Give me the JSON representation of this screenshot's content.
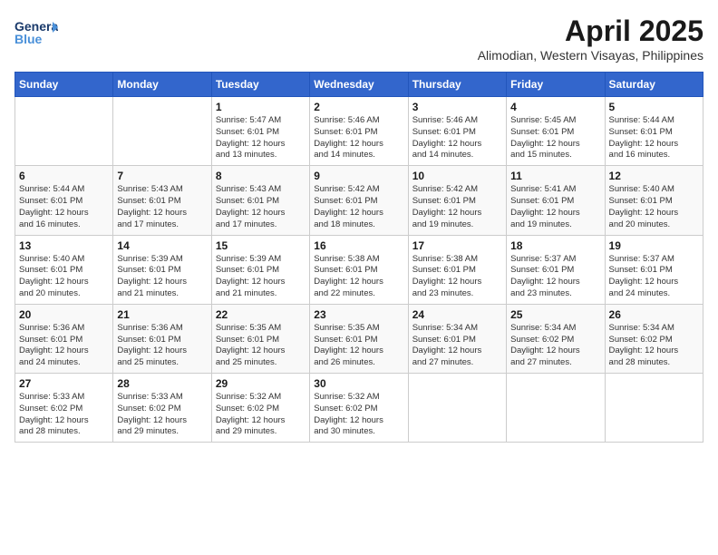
{
  "header": {
    "logo_line1": "General",
    "logo_line2": "Blue",
    "month_title": "April 2025",
    "location": "Alimodian, Western Visayas, Philippines"
  },
  "weekdays": [
    "Sunday",
    "Monday",
    "Tuesday",
    "Wednesday",
    "Thursday",
    "Friday",
    "Saturday"
  ],
  "weeks": [
    [
      {
        "day": "",
        "info": ""
      },
      {
        "day": "",
        "info": ""
      },
      {
        "day": "1",
        "info": "Sunrise: 5:47 AM\nSunset: 6:01 PM\nDaylight: 12 hours\nand 13 minutes."
      },
      {
        "day": "2",
        "info": "Sunrise: 5:46 AM\nSunset: 6:01 PM\nDaylight: 12 hours\nand 14 minutes."
      },
      {
        "day": "3",
        "info": "Sunrise: 5:46 AM\nSunset: 6:01 PM\nDaylight: 12 hours\nand 14 minutes."
      },
      {
        "day": "4",
        "info": "Sunrise: 5:45 AM\nSunset: 6:01 PM\nDaylight: 12 hours\nand 15 minutes."
      },
      {
        "day": "5",
        "info": "Sunrise: 5:44 AM\nSunset: 6:01 PM\nDaylight: 12 hours\nand 16 minutes."
      }
    ],
    [
      {
        "day": "6",
        "info": "Sunrise: 5:44 AM\nSunset: 6:01 PM\nDaylight: 12 hours\nand 16 minutes."
      },
      {
        "day": "7",
        "info": "Sunrise: 5:43 AM\nSunset: 6:01 PM\nDaylight: 12 hours\nand 17 minutes."
      },
      {
        "day": "8",
        "info": "Sunrise: 5:43 AM\nSunset: 6:01 PM\nDaylight: 12 hours\nand 17 minutes."
      },
      {
        "day": "9",
        "info": "Sunrise: 5:42 AM\nSunset: 6:01 PM\nDaylight: 12 hours\nand 18 minutes."
      },
      {
        "day": "10",
        "info": "Sunrise: 5:42 AM\nSunset: 6:01 PM\nDaylight: 12 hours\nand 19 minutes."
      },
      {
        "day": "11",
        "info": "Sunrise: 5:41 AM\nSunset: 6:01 PM\nDaylight: 12 hours\nand 19 minutes."
      },
      {
        "day": "12",
        "info": "Sunrise: 5:40 AM\nSunset: 6:01 PM\nDaylight: 12 hours\nand 20 minutes."
      }
    ],
    [
      {
        "day": "13",
        "info": "Sunrise: 5:40 AM\nSunset: 6:01 PM\nDaylight: 12 hours\nand 20 minutes."
      },
      {
        "day": "14",
        "info": "Sunrise: 5:39 AM\nSunset: 6:01 PM\nDaylight: 12 hours\nand 21 minutes."
      },
      {
        "day": "15",
        "info": "Sunrise: 5:39 AM\nSunset: 6:01 PM\nDaylight: 12 hours\nand 21 minutes."
      },
      {
        "day": "16",
        "info": "Sunrise: 5:38 AM\nSunset: 6:01 PM\nDaylight: 12 hours\nand 22 minutes."
      },
      {
        "day": "17",
        "info": "Sunrise: 5:38 AM\nSunset: 6:01 PM\nDaylight: 12 hours\nand 23 minutes."
      },
      {
        "day": "18",
        "info": "Sunrise: 5:37 AM\nSunset: 6:01 PM\nDaylight: 12 hours\nand 23 minutes."
      },
      {
        "day": "19",
        "info": "Sunrise: 5:37 AM\nSunset: 6:01 PM\nDaylight: 12 hours\nand 24 minutes."
      }
    ],
    [
      {
        "day": "20",
        "info": "Sunrise: 5:36 AM\nSunset: 6:01 PM\nDaylight: 12 hours\nand 24 minutes."
      },
      {
        "day": "21",
        "info": "Sunrise: 5:36 AM\nSunset: 6:01 PM\nDaylight: 12 hours\nand 25 minutes."
      },
      {
        "day": "22",
        "info": "Sunrise: 5:35 AM\nSunset: 6:01 PM\nDaylight: 12 hours\nand 25 minutes."
      },
      {
        "day": "23",
        "info": "Sunrise: 5:35 AM\nSunset: 6:01 PM\nDaylight: 12 hours\nand 26 minutes."
      },
      {
        "day": "24",
        "info": "Sunrise: 5:34 AM\nSunset: 6:01 PM\nDaylight: 12 hours\nand 27 minutes."
      },
      {
        "day": "25",
        "info": "Sunrise: 5:34 AM\nSunset: 6:02 PM\nDaylight: 12 hours\nand 27 minutes."
      },
      {
        "day": "26",
        "info": "Sunrise: 5:34 AM\nSunset: 6:02 PM\nDaylight: 12 hours\nand 28 minutes."
      }
    ],
    [
      {
        "day": "27",
        "info": "Sunrise: 5:33 AM\nSunset: 6:02 PM\nDaylight: 12 hours\nand 28 minutes."
      },
      {
        "day": "28",
        "info": "Sunrise: 5:33 AM\nSunset: 6:02 PM\nDaylight: 12 hours\nand 29 minutes."
      },
      {
        "day": "29",
        "info": "Sunrise: 5:32 AM\nSunset: 6:02 PM\nDaylight: 12 hours\nand 29 minutes."
      },
      {
        "day": "30",
        "info": "Sunrise: 5:32 AM\nSunset: 6:02 PM\nDaylight: 12 hours\nand 30 minutes."
      },
      {
        "day": "",
        "info": ""
      },
      {
        "day": "",
        "info": ""
      },
      {
        "day": "",
        "info": ""
      }
    ]
  ]
}
